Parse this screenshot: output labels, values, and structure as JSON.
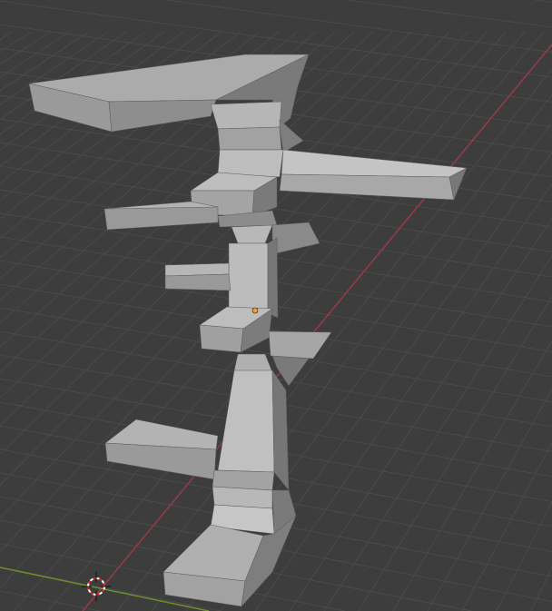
{
  "viewport": {
    "background": "#3d3d3d",
    "grid_color": "#4a4a4a",
    "x_axis_color": "#9a3a48",
    "y_axis_color": "#6e8f2c",
    "object_color": "#9e9e9e",
    "origin_dot_color": "#f0a030"
  },
  "icons": {
    "cursor": "3d-cursor-icon",
    "origin": "object-origin-icon"
  }
}
